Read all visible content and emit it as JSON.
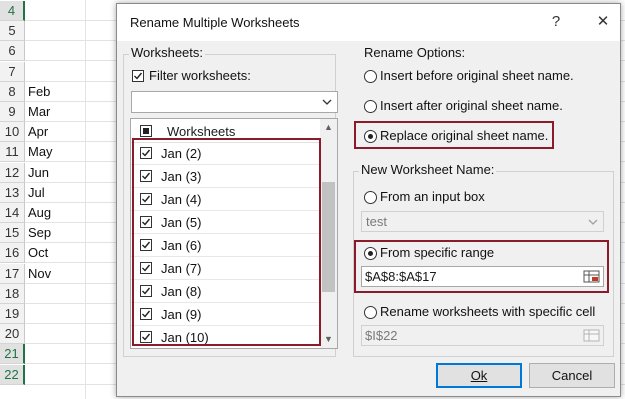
{
  "sheet": {
    "rows": [
      {
        "num": "4",
        "text": "",
        "selected": true
      },
      {
        "num": "5",
        "text": ""
      },
      {
        "num": "6",
        "text": ""
      },
      {
        "num": "7",
        "text": ""
      },
      {
        "num": "8",
        "text": "Feb"
      },
      {
        "num": "9",
        "text": "Mar"
      },
      {
        "num": "10",
        "text": "Apr"
      },
      {
        "num": "11",
        "text": "May"
      },
      {
        "num": "12",
        "text": "Jun"
      },
      {
        "num": "13",
        "text": "Jul"
      },
      {
        "num": "14",
        "text": "Aug"
      },
      {
        "num": "15",
        "text": "Sep"
      },
      {
        "num": "16",
        "text": "Oct"
      },
      {
        "num": "17",
        "text": "Nov"
      },
      {
        "num": "18",
        "text": ""
      },
      {
        "num": "19",
        "text": ""
      },
      {
        "num": "20",
        "text": ""
      },
      {
        "num": "21",
        "text": "",
        "selected": true
      },
      {
        "num": "22",
        "text": "",
        "selected": true
      }
    ]
  },
  "dialog": {
    "title": "Rename Multiple Worksheets",
    "help_glyph": "?",
    "close_glyph": "✕",
    "worksheets": {
      "group_label": "Worksheets:",
      "filter_label": "Filter worksheets:",
      "filter_checked": true,
      "filter_value": "",
      "list_header": "Worksheets",
      "items": [
        {
          "label": "Jan (2)",
          "checked": true
        },
        {
          "label": "Jan (3)",
          "checked": true
        },
        {
          "label": "Jan (4)",
          "checked": true
        },
        {
          "label": "Jan (5)",
          "checked": true
        },
        {
          "label": "Jan (6)",
          "checked": true
        },
        {
          "label": "Jan (7)",
          "checked": true
        },
        {
          "label": "Jan (8)",
          "checked": true
        },
        {
          "label": "Jan (9)",
          "checked": true
        },
        {
          "label": "Jan (10)",
          "checked": true
        }
      ]
    },
    "rename_options": {
      "group_label": "Rename Options:",
      "before_label": "Insert before original sheet name.",
      "after_label": "Insert after original sheet name.",
      "replace_label": "Replace original sheet name.",
      "selected": "replace"
    },
    "new_name": {
      "group_label": "New Worksheet Name:",
      "input_box_label": "From an input box",
      "input_box_value": "test",
      "range_label": "From specific range",
      "range_value": "$A$8:$A$17",
      "cell_label": "Rename worksheets with specific cell",
      "cell_value": "$I$22",
      "selected": "range"
    },
    "buttons": {
      "ok": "Ok",
      "cancel": "Cancel"
    }
  },
  "colors": {
    "highlight": "#8b1a2b",
    "accent": "#217346",
    "default_button": "#0078d7"
  }
}
